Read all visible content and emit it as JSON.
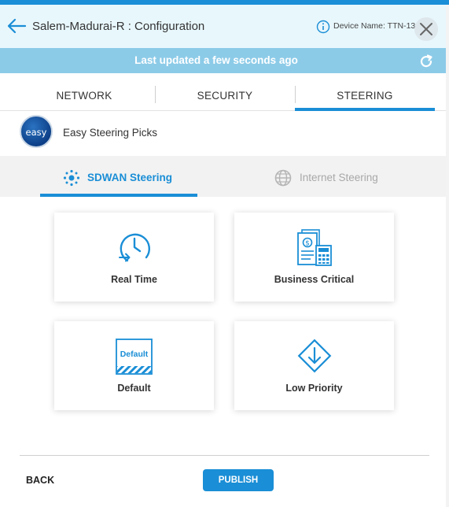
{
  "header": {
    "title": "Salem-Madurai-R : Configuration",
    "device_name": "Device Name: TTN-13",
    "icons": {
      "back": "arrow-left-icon",
      "info": "info-icon",
      "close": "close-icon"
    }
  },
  "status": {
    "text": "Last updated a few seconds ago",
    "icon": "refresh-icon"
  },
  "tabs": [
    {
      "label": "NETWORK",
      "active": false
    },
    {
      "label": "SECURITY",
      "active": false
    },
    {
      "label": "STEERING",
      "active": true
    }
  ],
  "easy": {
    "logo_text": "easy",
    "label": "Easy Steering Picks"
  },
  "steering_tabs": [
    {
      "label": "SDWAN Steering",
      "icon": "sdwan-icon",
      "active": true
    },
    {
      "label": "Internet Steering",
      "icon": "globe-icon",
      "active": false
    }
  ],
  "cards": [
    {
      "label": "Real Time",
      "icon": "clock-arrow-icon"
    },
    {
      "label": "Business Critical",
      "icon": "documents-calculator-icon"
    },
    {
      "label": "Default",
      "icon": "default-badge-icon",
      "badge_text": "Default"
    },
    {
      "label": "Low Priority",
      "icon": "diamond-arrow-down-icon"
    }
  ],
  "footer": {
    "back_label": "BACK",
    "publish_label": "PUBLISH"
  },
  "colors": {
    "accent": "#1a8ed6",
    "header_bg": "#e8f7fc",
    "status_bg": "#8ccbe8"
  }
}
